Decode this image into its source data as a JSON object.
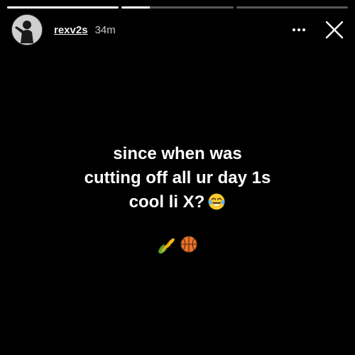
{
  "story": {
    "progress": [
      1.0,
      0.25,
      0.0
    ],
    "username": "rexv2s",
    "timestamp": "34m",
    "caption_lines": [
      "since when was",
      "cutting off all ur day 1s",
      "cool li X?"
    ],
    "icons": {
      "more": "more-options-icon",
      "close": "close-icon",
      "laughing": "tears-of-joy-emoji",
      "corn": "corn-emoji",
      "basketball": "basketball-emoji"
    }
  },
  "colors": {
    "background": "#000000",
    "text": "#ffffff",
    "progress_track": "rgba(255,255,255,0.35)",
    "progress_fill": "#ffffff"
  }
}
